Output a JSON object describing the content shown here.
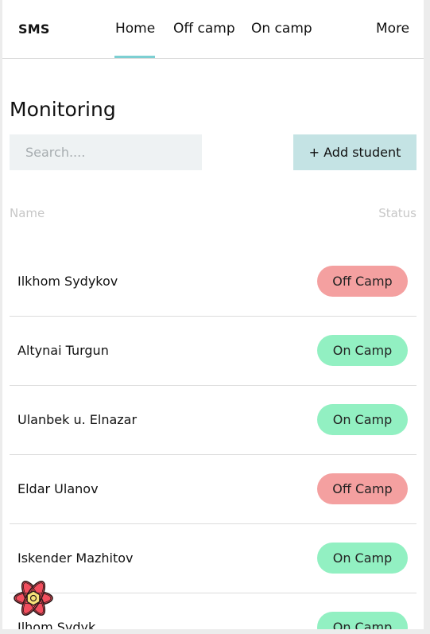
{
  "nav": {
    "brand": "SMS",
    "items": [
      {
        "label": "Home",
        "active": true
      },
      {
        "label": "Off camp"
      },
      {
        "label": "On camp"
      },
      {
        "label": "More"
      }
    ]
  },
  "page": {
    "title": "Monitoring"
  },
  "search": {
    "placeholder": "Search...."
  },
  "add_button": {
    "label": "+ Add student"
  },
  "table": {
    "headers": {
      "name": "Name",
      "status": "Status"
    },
    "rows": [
      {
        "name": "Ilkhom Sydykov",
        "status": "Off Camp"
      },
      {
        "name": "Altynai Turgun",
        "status": "On Camp"
      },
      {
        "name": "Ulanbek u. Elnazar",
        "status": "On Camp"
      },
      {
        "name": "Eldar Ulanov",
        "status": "Off Camp"
      },
      {
        "name": "Iskender Mazhitov",
        "status": "On Camp"
      },
      {
        "name": "Ilhom Sydyk",
        "status": "On Camp"
      }
    ]
  },
  "colors": {
    "accent": "#7ccfd2",
    "add_button_bg": "#c4e3e4",
    "off_camp": "#f4a0a0",
    "on_camp": "#92f0c2",
    "search_bg": "#eef2f3"
  },
  "icons": {
    "devtools": "react-atom-icon"
  }
}
